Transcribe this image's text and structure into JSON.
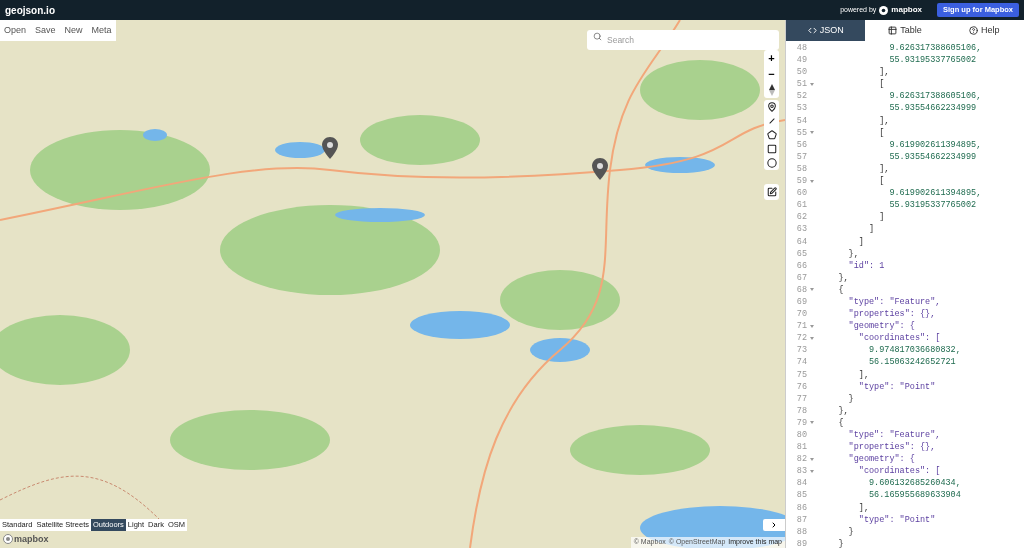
{
  "header": {
    "logo": "geojson.io",
    "powered_by": "powered by",
    "mapbox_wordmark": "mapbox",
    "signup_button": "Sign up for Mapbox"
  },
  "file_menu": [
    "Open",
    "Save",
    "New",
    "Meta"
  ],
  "search": {
    "placeholder": "Search"
  },
  "map_controls": [
    "+",
    "−"
  ],
  "layers": [
    {
      "label": "Standard",
      "selected": false
    },
    {
      "label": "Satellite Streets",
      "selected": false
    },
    {
      "label": "Outdoors",
      "selected": true
    },
    {
      "label": "Light",
      "selected": false
    },
    {
      "label": "Dark",
      "selected": false
    },
    {
      "label": "OSM",
      "selected": false
    }
  ],
  "map_logo": "mapbox",
  "attribution": [
    {
      "label": "© Mapbox"
    },
    {
      "label": "© OpenStreetMap"
    },
    {
      "label": "Improve this map"
    }
  ],
  "tabs": [
    {
      "label": "JSON",
      "selected": true
    },
    {
      "label": "Table",
      "selected": false
    },
    {
      "label": "Help",
      "selected": false
    }
  ],
  "code_lines": [
    {
      "num": "48",
      "text": "              9.626317388605106,",
      "kind": "number",
      "foldable": false
    },
    {
      "num": "49",
      "text": "              55.93195337765002",
      "kind": "number",
      "foldable": false
    },
    {
      "num": "50",
      "text": "            ],",
      "kind": "punct",
      "foldable": false
    },
    {
      "num": "51",
      "text": "            [",
      "kind": "punct",
      "foldable": true
    },
    {
      "num": "52",
      "text": "              9.626317388605106,",
      "kind": "number",
      "foldable": false
    },
    {
      "num": "53",
      "text": "              55.93554662234999",
      "kind": "number",
      "foldable": false
    },
    {
      "num": "54",
      "text": "            ],",
      "kind": "punct",
      "foldable": false
    },
    {
      "num": "55",
      "text": "            [",
      "kind": "punct",
      "foldable": true
    },
    {
      "num": "56",
      "text": "              9.619902611394895,",
      "kind": "number",
      "foldable": false
    },
    {
      "num": "57",
      "text": "              55.93554662234999",
      "kind": "number",
      "foldable": false
    },
    {
      "num": "58",
      "text": "            ],",
      "kind": "punct",
      "foldable": false
    },
    {
      "num": "59",
      "text": "            [",
      "kind": "punct",
      "foldable": true
    },
    {
      "num": "60",
      "text": "              9.619902611394895,",
      "kind": "number",
      "foldable": false
    },
    {
      "num": "61",
      "text": "              55.93195337765002",
      "kind": "number",
      "foldable": false
    },
    {
      "num": "62",
      "text": "            ]",
      "kind": "punct",
      "foldable": false
    },
    {
      "num": "63",
      "text": "          ]",
      "kind": "punct",
      "foldable": false
    },
    {
      "num": "64",
      "text": "        ]",
      "kind": "punct",
      "foldable": false
    },
    {
      "num": "65",
      "text": "      },",
      "kind": "punct",
      "foldable": false
    },
    {
      "num": "66",
      "text": "      \"id\": 1",
      "kind": "key",
      "foldable": false
    },
    {
      "num": "67",
      "text": "    },",
      "kind": "punct",
      "foldable": false
    },
    {
      "num": "68",
      "text": "    {",
      "kind": "punct",
      "foldable": true
    },
    {
      "num": "69",
      "text": "      \"type\": \"Feature\",",
      "kind": "key",
      "foldable": false
    },
    {
      "num": "70",
      "text": "      \"properties\": {},",
      "kind": "key",
      "foldable": false
    },
    {
      "num": "71",
      "text": "      \"geometry\": {",
      "kind": "key",
      "foldable": true
    },
    {
      "num": "72",
      "text": "        \"coordinates\": [",
      "kind": "key",
      "foldable": true
    },
    {
      "num": "73",
      "text": "          9.974817036680832,",
      "kind": "number",
      "foldable": false
    },
    {
      "num": "74",
      "text": "          56.15063242652721",
      "kind": "number",
      "foldable": false
    },
    {
      "num": "75",
      "text": "        ],",
      "kind": "punct",
      "foldable": false
    },
    {
      "num": "76",
      "text": "        \"type\": \"Point\"",
      "kind": "key",
      "foldable": false
    },
    {
      "num": "77",
      "text": "      }",
      "kind": "punct",
      "foldable": false
    },
    {
      "num": "78",
      "text": "    },",
      "kind": "punct",
      "foldable": false
    },
    {
      "num": "79",
      "text": "    {",
      "kind": "punct",
      "foldable": true
    },
    {
      "num": "80",
      "text": "      \"type\": \"Feature\",",
      "kind": "key",
      "foldable": false
    },
    {
      "num": "81",
      "text": "      \"properties\": {},",
      "kind": "key",
      "foldable": false
    },
    {
      "num": "82",
      "text": "      \"geometry\": {",
      "kind": "key",
      "foldable": true
    },
    {
      "num": "83",
      "text": "        \"coordinates\": [",
      "kind": "key",
      "foldable": true
    },
    {
      "num": "84",
      "text": "          9.606132685260434,",
      "kind": "number",
      "foldable": false
    },
    {
      "num": "85",
      "text": "          56.165955689633904",
      "kind": "number",
      "foldable": false
    },
    {
      "num": "86",
      "text": "        ],",
      "kind": "punct",
      "foldable": false
    },
    {
      "num": "87",
      "text": "        \"type\": \"Point\"",
      "kind": "key",
      "foldable": false
    },
    {
      "num": "88",
      "text": "      }",
      "kind": "punct",
      "foldable": false
    },
    {
      "num": "89",
      "text": "    }",
      "kind": "punct",
      "foldable": false
    }
  ]
}
